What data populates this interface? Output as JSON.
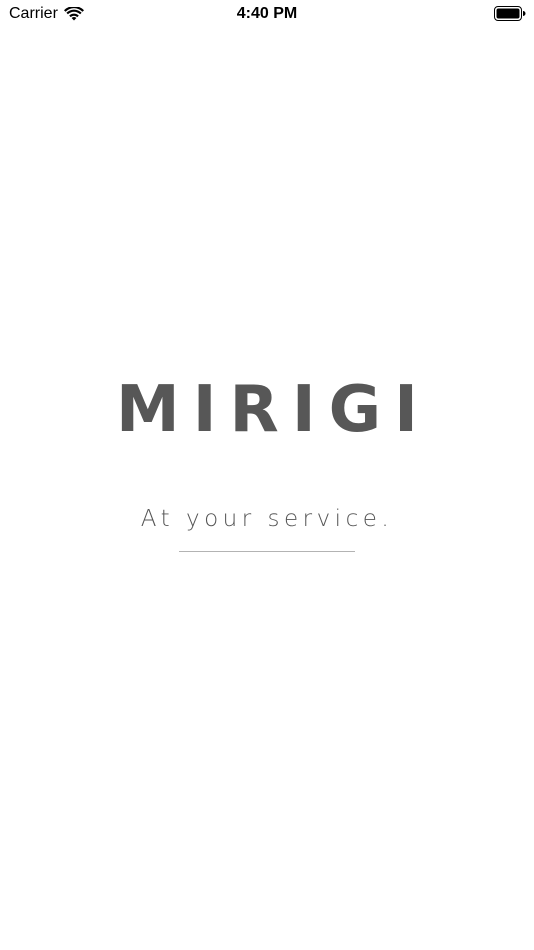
{
  "status_bar": {
    "carrier": "Carrier",
    "time": "4:40 PM"
  },
  "splash": {
    "logo": "MIRIGI",
    "tagline": "At your service."
  },
  "icons": {
    "wifi": "wifi-icon",
    "battery": "battery-icon"
  },
  "colors": {
    "background": "#ffffff",
    "logo": "#575757",
    "tagline": "#555555",
    "divider": "#b3b3b3"
  }
}
